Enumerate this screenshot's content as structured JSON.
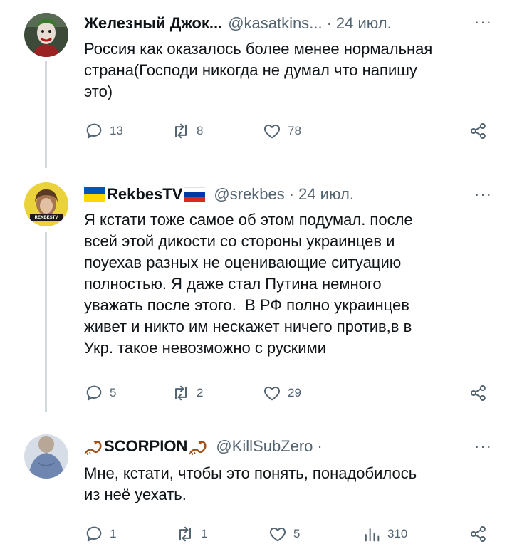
{
  "tweets": [
    {
      "author": "Железный Джок...",
      "handle": "@kasatkins...",
      "dot": "·",
      "date": "24 июл.",
      "more": "···",
      "text": "Россия как оказалось более менее нормальная\nстрана(Господи никогда не думал что напишу\nэто)",
      "replies": "13",
      "retweets": "8",
      "likes": "78"
    },
    {
      "author": "RekbesTV",
      "handle": "@srekbes",
      "dot": "·",
      "date": "24 июл.",
      "more": "···",
      "avatar_caption": "REKBESTV",
      "text": "Я кстати тоже самое об этом подумал. после\nвсей этой дикости со стороны украинцев и\nпоуехав разных не оценивающие ситуацию\nполностью. Я даже стал Путина немного\nуважать после этого.  В РФ полно украинцев\nживет и никто им нескажет ничего против,в в\nУкр. такое невозможно с рускими",
      "replies": "5",
      "retweets": "2",
      "likes": "29"
    },
    {
      "author": "SCORPION",
      "handle": "@KillSubZero",
      "dot": "·",
      "more": "···",
      "text": "Мне, кстати, чтобы это понять, понадобилось\nиз неё уехать.",
      "replies": "1",
      "retweets": "1",
      "likes": "5",
      "views": "310"
    }
  ],
  "colors": {
    "text": "#0f1419",
    "secondary": "#536471",
    "thread_line": "#cfd9de",
    "flag_blue": "#0057b7",
    "flag_yellow": "#ffd700",
    "flag_red": "#d52b1e"
  },
  "icons": [
    "reply-icon",
    "retweet-icon",
    "like-icon",
    "views-icon",
    "share-icon",
    "scorpion-icon"
  ]
}
